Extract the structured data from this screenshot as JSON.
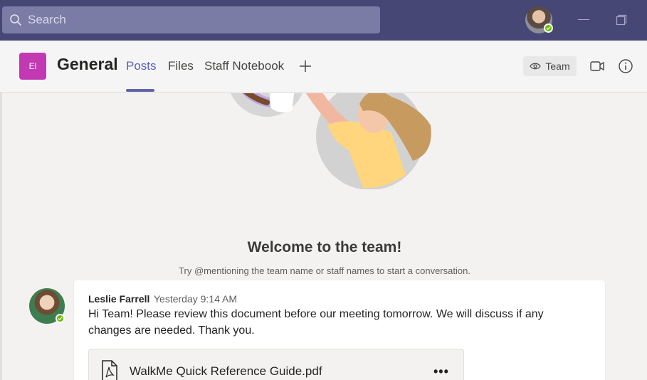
{
  "search": {
    "placeholder": "Search"
  },
  "channel": {
    "team_initials": "El",
    "name": "General",
    "tabs": [
      "Posts",
      "Files",
      "Staff Notebook"
    ],
    "active_tab": "Posts",
    "team_button": "Team"
  },
  "welcome": {
    "title": "Welcome to the team!",
    "subtitle": "Try @mentioning the team name or staff names to start a conversation."
  },
  "message": {
    "author": "Leslie Farrell",
    "time": "Yesterday 9:14 AM",
    "body": "Hi Team! Please review this document before our meeting tomorrow.  We will discuss if any changes are needed.  Thank you.",
    "attachment": {
      "name": "WalkMe Quick Reference Guide.pdf",
      "icon": "pdf-file-icon"
    }
  },
  "colors": {
    "title_bar": "#464775",
    "accent": "#6264a7",
    "team_tile": "#c239b3",
    "presence_available": "#6bb700"
  }
}
